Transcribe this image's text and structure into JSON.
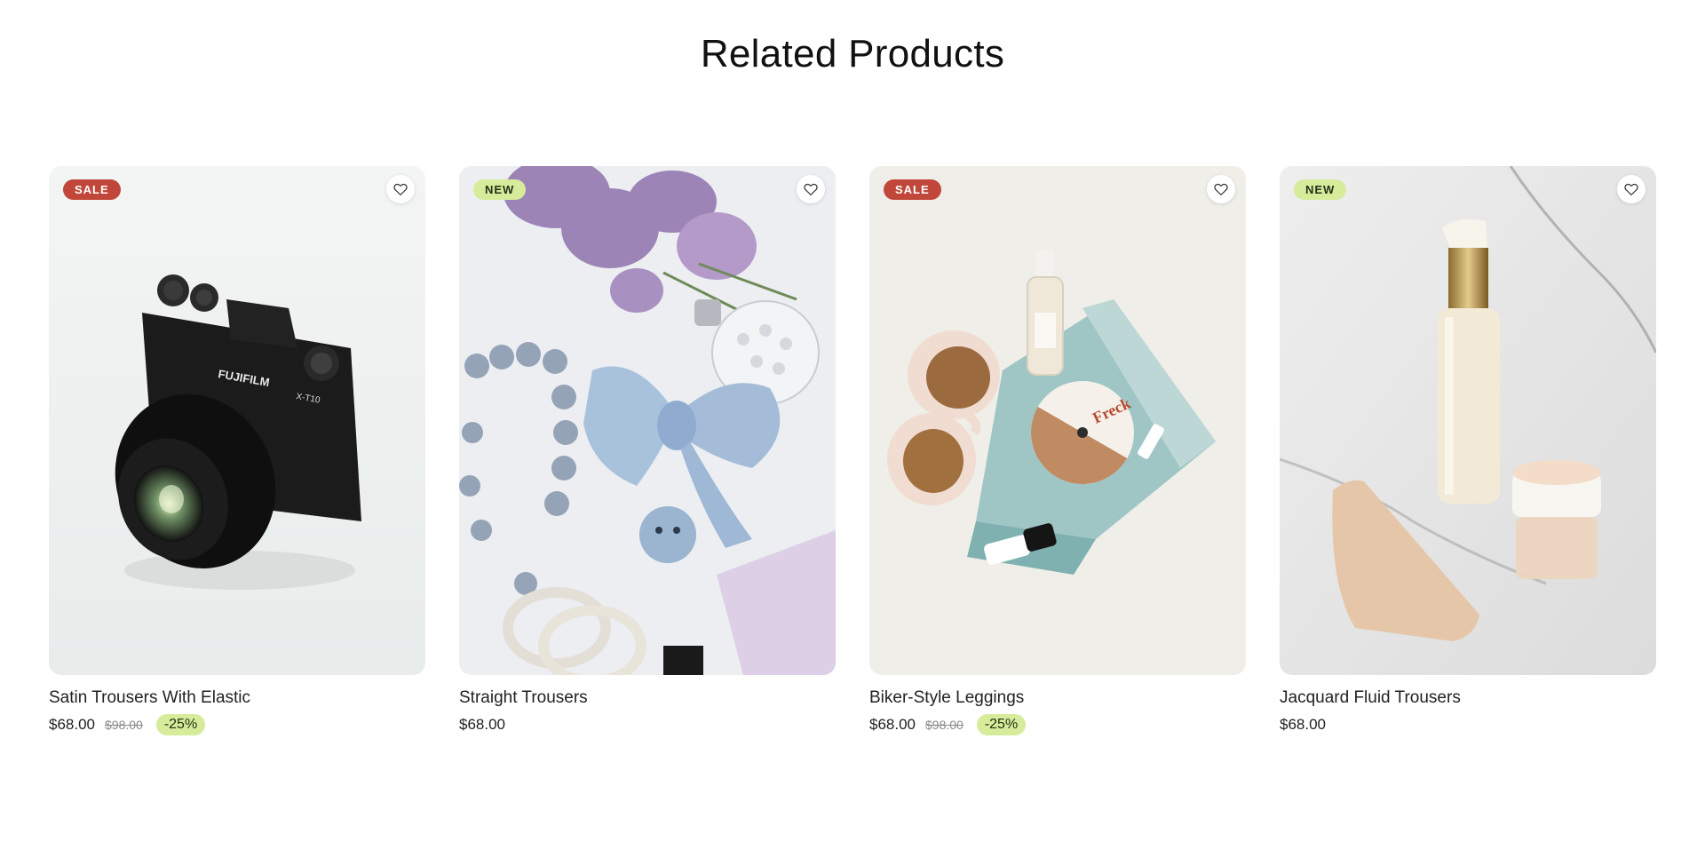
{
  "section": {
    "title": "Related Products"
  },
  "products": [
    {
      "badge": "SALE",
      "badge_type": "sale",
      "name": "Satin Trousers With Elastic",
      "price": "$68.00",
      "compare_price": "$98.00",
      "discount": "-25%",
      "image_icon": "camera"
    },
    {
      "badge": "NEW",
      "badge_type": "new",
      "name": "Straight Trousers",
      "price": "$68.00",
      "compare_price": "",
      "discount": "",
      "image_icon": "bow-perfume"
    },
    {
      "badge": "SALE",
      "badge_type": "sale",
      "name": "Biker-Style Leggings",
      "price": "$68.00",
      "compare_price": "$98.00",
      "discount": "-25%",
      "image_icon": "sunglasses-cosmetics"
    },
    {
      "badge": "NEW",
      "badge_type": "new",
      "name": "Jacquard Fluid Trousers",
      "price": "$68.00",
      "compare_price": "",
      "discount": "",
      "image_icon": "bottle-tube-jar"
    }
  ],
  "photo_texts": {
    "camera_brand": "FUJIFILM",
    "camera_model": "X-T10",
    "card_word": "Freck"
  },
  "colors": {
    "sale_badge": "#c0473a",
    "new_badge": "#d6ec9b",
    "discount_badge": "#d6ec9b"
  },
  "icons": {
    "wishlist": "heart-icon"
  }
}
